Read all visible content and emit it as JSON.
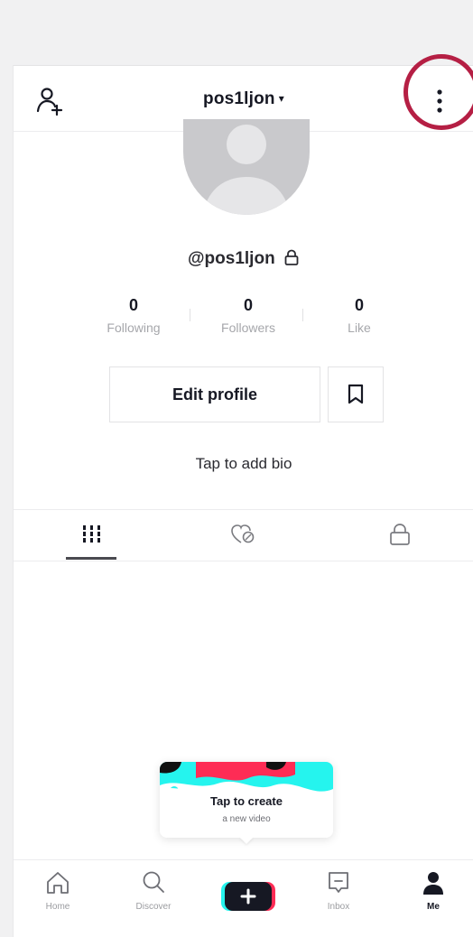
{
  "header": {
    "username": "pos1ljon",
    "caret": "▾",
    "add_user_icon": "add-user-icon",
    "more_icon": "more-vertical-icon",
    "highlight_color": "#b51f44"
  },
  "profile": {
    "handle": "@pos1ljon",
    "bio_prompt": "Tap to add bio"
  },
  "stats": [
    {
      "value": "0",
      "label": "Following"
    },
    {
      "value": "0",
      "label": "Followers"
    },
    {
      "value": "0",
      "label": "Like"
    }
  ],
  "actions": {
    "edit_profile": "Edit profile"
  },
  "tabs": [
    {
      "icon": "grid-icon",
      "active": true
    },
    {
      "icon": "liked-hearts-icon",
      "active": false
    },
    {
      "icon": "lock-icon",
      "active": false
    }
  ],
  "tooltip": {
    "title": "Tap to create",
    "subtitle": "a new video"
  },
  "nav": [
    {
      "label": "Home",
      "icon": "home-icon"
    },
    {
      "label": "Discover",
      "icon": "search-icon"
    },
    {
      "label": "",
      "icon": "plus-icon"
    },
    {
      "label": "Inbox",
      "icon": "inbox-icon"
    },
    {
      "label": "Me",
      "icon": "person-icon",
      "active": true
    }
  ],
  "colors": {
    "brand_cyan": "#25f4ee",
    "brand_red": "#fe2c55",
    "text": "#161823",
    "muted": "#a6a7ab"
  }
}
